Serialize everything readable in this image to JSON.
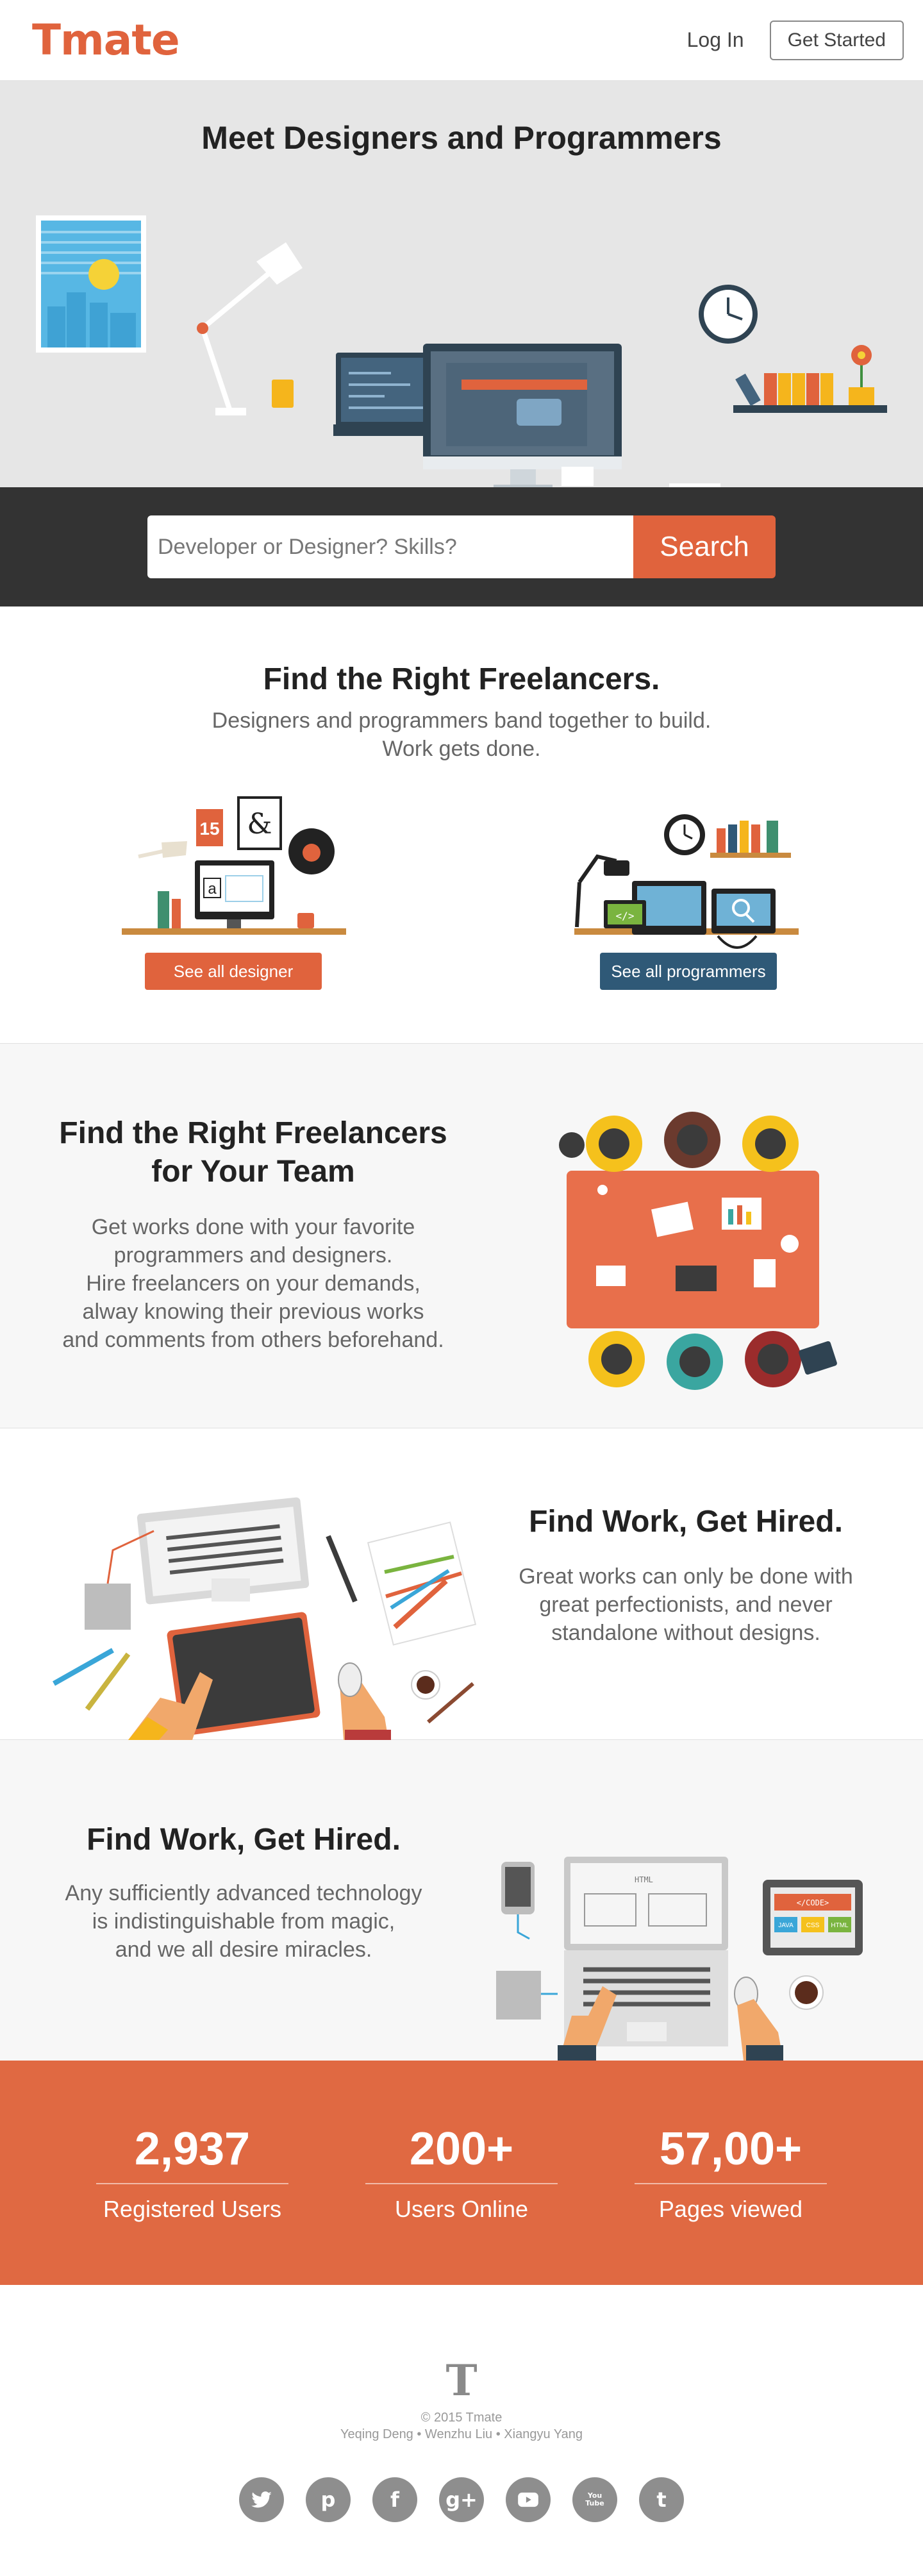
{
  "header": {
    "logo": "Tmate",
    "login_label": "Log In",
    "cta_label": "Get Started"
  },
  "hero": {
    "title": "Meet Designers and Programmers"
  },
  "search": {
    "placeholder": "Developer or Designer? Skills?",
    "button_label": "Search"
  },
  "section1": {
    "title": "Find the Right Freelancers.",
    "subtitle_line1": "Designers and programmers band together to build.",
    "subtitle_line2": "Work gets done.",
    "designer_button": "See all designer",
    "programmer_button": "See all programmers",
    "calendar_number": "15",
    "ampersand": "&",
    "letter_a": "a"
  },
  "section2": {
    "title_line1": "Find the Right Freelancers",
    "title_line2": "for Your Team",
    "lines": [
      "Get works done with your favorite",
      "programmers and designers.",
      "Hire freelancers on your demands,",
      "alway knowing their previous works",
      "and comments from others beforehand."
    ]
  },
  "section3": {
    "title": "Find Work, Get Hired.",
    "lines": [
      "Great works can only be done with",
      "great perfectionists, and never",
      "standalone without designs."
    ]
  },
  "section4": {
    "title": "Find Work, Get Hired.",
    "lines": [
      "Any sufficiently advanced technology",
      "is indistinguishable from magic,",
      "and we all desire miracles."
    ],
    "tablet_code": "</CODE>",
    "tablet_tags": [
      "JAVA",
      "CSS",
      "HTML"
    ],
    "monitor_text": "HTML"
  },
  "stats": [
    {
      "value": "2,937",
      "label": "Registered Users"
    },
    {
      "value": "200+",
      "label": "Users Online"
    },
    {
      "value": "57,00+",
      "label": "Pages viewed"
    }
  ],
  "footer": {
    "logo": "T",
    "copyright": "© 2015 Tmate",
    "authors": "Yeqing Deng • Wenzhu Liu • Xiangyu Yang",
    "socials": [
      "twitter",
      "pinterest",
      "facebook",
      "google-plus",
      "youtube-play",
      "youtube",
      "tumblr"
    ],
    "social_glyphs": {
      "pinterest": "p",
      "facebook": "f",
      "google": "g+",
      "tumblr": "t",
      "youtube_text": "You Tube"
    }
  },
  "colors": {
    "brand": "#e0633d",
    "dark_bar": "#333333",
    "navy": "#2f5977",
    "stats_bg": "#e06942"
  }
}
